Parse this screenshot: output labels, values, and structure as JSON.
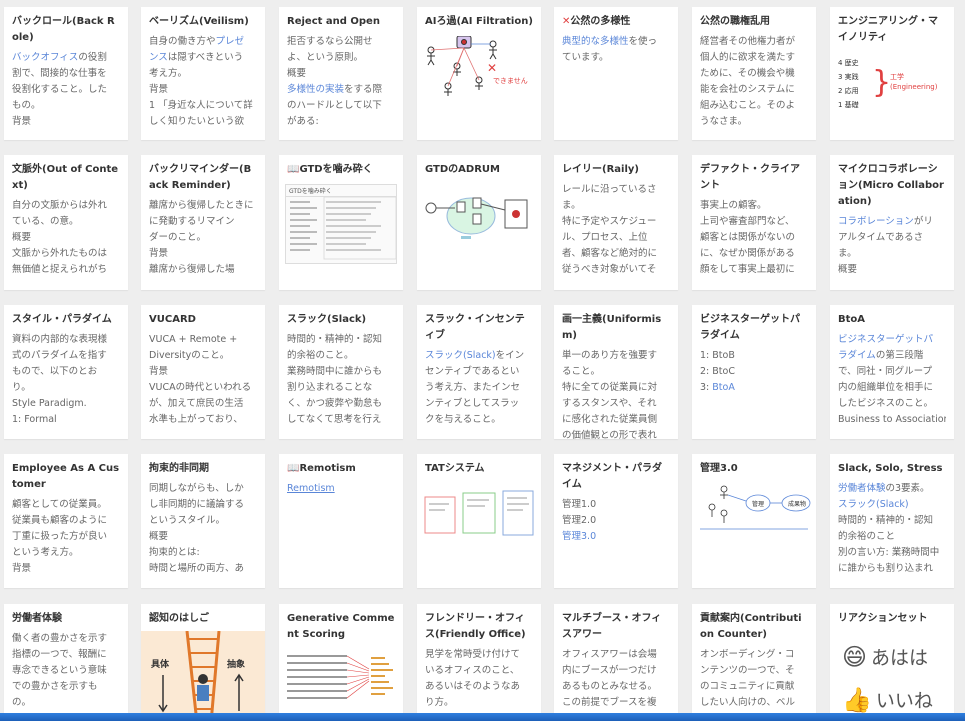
{
  "cards": [
    {
      "title": "バックロール(Back Role)",
      "body": [
        [
          {
            "t": "バックオフィス",
            "l": 1
          },
          {
            "t": "の役割"
          }
        ],
        [
          {
            "t": "割で、間接的な仕事を"
          }
        ],
        [
          {
            "t": "役割化すること。した"
          }
        ],
        [
          {
            "t": "もの。"
          }
        ],
        [
          {
            "t": "背景"
          }
        ]
      ]
    },
    {
      "title": "ベーリズム(Veilism)",
      "body": [
        [
          {
            "t": "自身の働き方や"
          },
          {
            "t": "プレゼ",
            "l": 1
          }
        ],
        [
          {
            "t": "ンス",
            "l": 1
          },
          {
            "t": "は隠すべきという"
          }
        ],
        [
          {
            "t": "考え方。"
          }
        ],
        [
          {
            "t": "背景"
          }
        ],
        [
          {
            "t": "1 「身近な人について詳"
          }
        ],
        [
          {
            "t": "しく知りたいという欲"
          }
        ]
      ]
    },
    {
      "title": "Reject and Open",
      "body": [
        [
          {
            "t": "拒否するなら公開せ"
          }
        ],
        [
          {
            "t": "よ、という原則。"
          }
        ],
        [
          {
            "t": "概要"
          }
        ],
        [
          {
            "t": "多様性の実装",
            "l": 1
          },
          {
            "t": "をする際"
          }
        ],
        [
          {
            "t": "のハードルとして以下"
          }
        ],
        [
          {
            "t": "がある:"
          }
        ]
      ]
    },
    {
      "title": "AIろ過(AI Filtration)",
      "thumb": "ai"
    },
    {
      "title": "公然の多様性",
      "mark": "✕",
      "body": [
        [
          {
            "t": "典型的な多様性",
            "l": 1
          },
          {
            "t": "を使っ"
          }
        ],
        [
          {
            "t": "ています。"
          }
        ]
      ]
    },
    {
      "title": "公然の職権乱用",
      "body": [
        [
          {
            "t": "経営者その他権力者が"
          }
        ],
        [
          {
            "t": "個人的に欲求を満たす"
          }
        ],
        [
          {
            "t": "ために、その機会や機"
          }
        ],
        [
          {
            "t": "能を会社のシステムに"
          }
        ],
        [
          {
            "t": "組み込むこと。そのよ"
          }
        ],
        [
          {
            "t": "うなさま。"
          }
        ]
      ]
    },
    {
      "title": "エンジニアリング・マイノリティ",
      "thumb": "eng"
    },
    {
      "title": "文脈外(Out of Context)",
      "body": [
        [
          {
            "t": "自分の文脈からは外れ"
          }
        ],
        [
          {
            "t": "ている、の意。"
          }
        ],
        [
          {
            "t": "概要"
          }
        ],
        [
          {
            "t": "文脈から外れたものは"
          }
        ],
        [
          {
            "t": "無価値と捉えられがち"
          }
        ]
      ]
    },
    {
      "title": "バックリマインダー(Back Reminder)",
      "body": [
        [
          {
            "t": "離席から復帰したときに"
          }
        ],
        [
          {
            "t": "に発動するリマイン"
          }
        ],
        [
          {
            "t": "ダーのこと。"
          }
        ],
        [
          {
            "t": "背景"
          }
        ],
        [
          {
            "t": "離席から復帰した場"
          }
        ]
      ]
    },
    {
      "title": "GTDを噛み砕く",
      "icon": "📖",
      "thumb": "gtd"
    },
    {
      "title": "GTDのADRUM",
      "thumb": "adrum"
    },
    {
      "title": "レイリー(Raily)",
      "body": [
        [
          {
            "t": "レールに沿っているさ"
          }
        ],
        [
          {
            "t": "ま。"
          }
        ],
        [
          {
            "t": "特に予定やスケジュー"
          }
        ],
        [
          {
            "t": "ル、プロセス、上位"
          }
        ],
        [
          {
            "t": "者、顧客など絶対的に"
          }
        ],
        [
          {
            "t": "従うべき対象がいてそ"
          }
        ]
      ]
    },
    {
      "title": "デファクト・クライアント",
      "body": [
        [
          {
            "t": "事実上の顧客。"
          }
        ],
        [
          {
            "t": "上司や審査部門など、"
          }
        ],
        [
          {
            "t": "顧客とは関係がないの"
          }
        ],
        [
          {
            "t": "に、なぜか関係がある"
          }
        ],
        [
          {
            "t": "顔をして事実上最初に"
          }
        ]
      ]
    },
    {
      "title": "マイクロコラボレーション(Micro Collaboration)",
      "body": [
        [
          {
            "t": "コラボレーション",
            "l": 1
          },
          {
            "t": "がリ"
          }
        ],
        [
          {
            "t": "アルタイムであるさ"
          }
        ],
        [
          {
            "t": "ま。"
          }
        ],
        [
          {
            "t": "概要"
          }
        ]
      ]
    },
    {
      "title": "スタイル・パラダイム",
      "body": [
        [
          {
            "t": "資料の内部的な表現様"
          }
        ],
        [
          {
            "t": "式のパラダイムを指す"
          }
        ],
        [
          {
            "t": "もので、以下のとお"
          }
        ],
        [
          {
            "t": "り。"
          }
        ],
        [
          {
            "t": "Style Paradigm."
          }
        ],
        [
          {
            "t": "1: Formal"
          }
        ]
      ]
    },
    {
      "title": "VUCARD",
      "body": [
        [
          {
            "t": "VUCA + Remote +"
          }
        ],
        [
          {
            "t": "Diversityのこと。"
          }
        ],
        [
          {
            "t": "背景"
          }
        ],
        [
          {
            "t": "VUCAの時代といわれる"
          }
        ],
        [
          {
            "t": "が、加えて庶民の生活"
          }
        ],
        [
          {
            "t": "水準も上がっており、"
          }
        ]
      ]
    },
    {
      "title": "スラック(Slack)",
      "body": [
        [
          {
            "t": "時間的・精神的・認知"
          }
        ],
        [
          {
            "t": "的余裕のこと。"
          }
        ],
        [
          {
            "t": "業務時間中に誰からも"
          }
        ],
        [
          {
            "t": "割り込まれることな"
          }
        ],
        [
          {
            "t": "く、かつ疲弊や勤怠も"
          }
        ],
        [
          {
            "t": "してなくて思考を行え"
          }
        ]
      ]
    },
    {
      "title": "スラック・インセンティブ",
      "body": [
        [
          {
            "t": "スラック(Slack)",
            "l": 1
          },
          {
            "t": "をイン"
          }
        ],
        [
          {
            "t": "センティブであるとい"
          }
        ],
        [
          {
            "t": "う考え方、またインセ"
          }
        ],
        [
          {
            "t": "ンティブとしてスラッ"
          }
        ],
        [
          {
            "t": "クを与えること。"
          }
        ]
      ]
    },
    {
      "title": "画一主義(Uniformism)",
      "body": [
        [
          {
            "t": "単一のあり方を強要す"
          }
        ],
        [
          {
            "t": "ること。"
          }
        ],
        [
          {
            "t": "特に全ての従業員に対"
          }
        ],
        [
          {
            "t": "するスタンスや、それ"
          }
        ],
        [
          {
            "t": "に感化された従業員側"
          }
        ],
        [
          {
            "t": "の価値観との形で表れ"
          }
        ]
      ]
    },
    {
      "title": "ビジネスターゲットパラダイム",
      "body": [
        [
          {
            "t": "1: BtoB"
          }
        ],
        [
          {
            "t": "2: BtoC"
          }
        ],
        [
          {
            "t": "3: "
          },
          {
            "t": "BtoA",
            "l": 1
          }
        ]
      ]
    },
    {
      "title": "BtoA",
      "body": [
        [
          {
            "t": "ビジネスターゲットパ",
            "l": 1
          }
        ],
        [
          {
            "t": "ラダイム",
            "l": 1
          },
          {
            "t": "の第三段階"
          }
        ],
        [
          {
            "t": "で、同社・同グループ"
          }
        ],
        [
          {
            "t": "内の組織単位を相手に"
          }
        ],
        [
          {
            "t": "したビジネスのこと。"
          }
        ],
        [
          {
            "t": "Business to Association"
          }
        ]
      ]
    },
    {
      "title": "Employee As A Customer",
      "body": [
        [
          {
            "t": "顧客としての従業員。"
          }
        ],
        [
          {
            "t": "従業員も顧客のように"
          }
        ],
        [
          {
            "t": "丁重に扱った方が良い"
          }
        ],
        [
          {
            "t": "という考え方。"
          }
        ],
        [
          {
            "t": "背景"
          }
        ]
      ]
    },
    {
      "title": "拘束的非同期",
      "body": [
        [
          {
            "t": "同期しながらも、しか"
          }
        ],
        [
          {
            "t": "し非同期的に議論する"
          }
        ],
        [
          {
            "t": "というスタイル。"
          }
        ],
        [
          {
            "t": "概要"
          }
        ],
        [
          {
            "t": "拘束的とは:"
          }
        ],
        [
          {
            "t": "時間と場所の両方、あ"
          }
        ]
      ]
    },
    {
      "title": "Remotism",
      "icon": "📖",
      "body": [
        [
          {
            "t": "Remotism",
            "l": 1,
            "u": 1
          }
        ]
      ]
    },
    {
      "title": "TATシステム",
      "thumb": "tat"
    },
    {
      "title": "マネジメント・パラダイム",
      "body": [
        [
          {
            "t": "管理1.0"
          }
        ],
        [
          {
            "t": "管理2.0"
          }
        ],
        [
          {
            "t": "管理3.0",
            "l": 1
          }
        ]
      ]
    },
    {
      "title": "管理3.0",
      "thumb": "kanri"
    },
    {
      "title": "Slack, Solo, Stress",
      "body": [
        [
          {
            "t": "労働者体験",
            "l": 1
          },
          {
            "t": "の3要素。"
          }
        ],
        [
          {
            "t": "スラック(Slack)",
            "l": 1
          }
        ],
        [
          {
            "t": "時間的・精神的・認知"
          }
        ],
        [
          {
            "t": "的余裕のこと"
          }
        ],
        [
          {
            "t": "別の言い方: 業務時間中"
          }
        ],
        [
          {
            "t": "に誰からも割り込まれ"
          }
        ]
      ]
    },
    {
      "title": "労働者体験",
      "body": [
        [
          {
            "t": "働く者の豊かさを示す"
          }
        ],
        [
          {
            "t": "指標の一つで、報酬に"
          }
        ],
        [
          {
            "t": "専念できるという意味"
          }
        ],
        [
          {
            "t": "での豊かさを示すも"
          }
        ],
        [
          {
            "t": "の。"
          }
        ]
      ]
    },
    {
      "title": "認知のはしご",
      "thumb": "ladder"
    },
    {
      "title": "Generative Comment Scoring",
      "thumb": "gcs"
    },
    {
      "title": "フレンドリー・オフィス(Friendly Office)",
      "body": [
        [
          {
            "t": "見学を常時受け付けて"
          }
        ],
        [
          {
            "t": "いるオフィスのこと、"
          }
        ],
        [
          {
            "t": "あるいはそのようなあ"
          }
        ],
        [
          {
            "t": "り方。"
          }
        ]
      ]
    },
    {
      "title": "マルチブース・オフィスアワー",
      "body": [
        [
          {
            "t": "オフィスアワーは会場"
          }
        ],
        [
          {
            "t": "内にブースが一つだけ"
          }
        ],
        [
          {
            "t": "あるものとみなせる。"
          }
        ],
        [
          {
            "t": "この前提でブースを複"
          }
        ]
      ]
    },
    {
      "title": "貢献案内(Contribution Counter)",
      "body": [
        [
          {
            "t": "オンボーディング・コ"
          }
        ],
        [
          {
            "t": "ンテンツの一つで、そ"
          }
        ],
        [
          {
            "t": "のコミュニティに貢献"
          }
        ],
        [
          {
            "t": "したい人向けの、ベル"
          }
        ]
      ]
    },
    {
      "title": "リアクションセット",
      "thumb": "react"
    }
  ],
  "thumbs": {
    "ai": {
      "label": "できません"
    },
    "eng": {
      "rows": [
        "4 歴史",
        "3 実践",
        "2 応用",
        "1 基礎"
      ],
      "note": "工学",
      "note2": "(Engineering)"
    },
    "gtd": {
      "head": "GTDを噛み砕く"
    },
    "ladder": {
      "left": "具体",
      "right": "抽象"
    },
    "kanri": {
      "a": "管理",
      "b": "成果物"
    },
    "react": {
      "e1": "😄",
      "t1": "あはは",
      "e2": "👍",
      "t2": "いいね"
    }
  },
  "colors": {
    "link": "#5a86d8",
    "accent_red": "#e04040",
    "taskbar": "#2f7fdf"
  }
}
